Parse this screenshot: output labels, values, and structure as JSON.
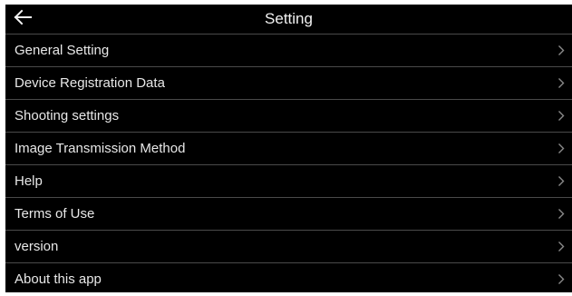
{
  "header": {
    "title": "Setting",
    "back_icon": "arrow-left-icon"
  },
  "menu": {
    "chevron_icon": "chevron-right-icon",
    "items": [
      {
        "label": "General Setting"
      },
      {
        "label": "Device Registration Data"
      },
      {
        "label": "Shooting settings"
      },
      {
        "label": "Image Transmission Method"
      },
      {
        "label": "Help"
      },
      {
        "label": "Terms of Use"
      },
      {
        "label": "version"
      },
      {
        "label": "About this app"
      }
    ]
  },
  "colors": {
    "background": "#000000",
    "text": "#e8e8e8",
    "divider": "#4a4a4a",
    "chevron": "#8a8a8a"
  }
}
